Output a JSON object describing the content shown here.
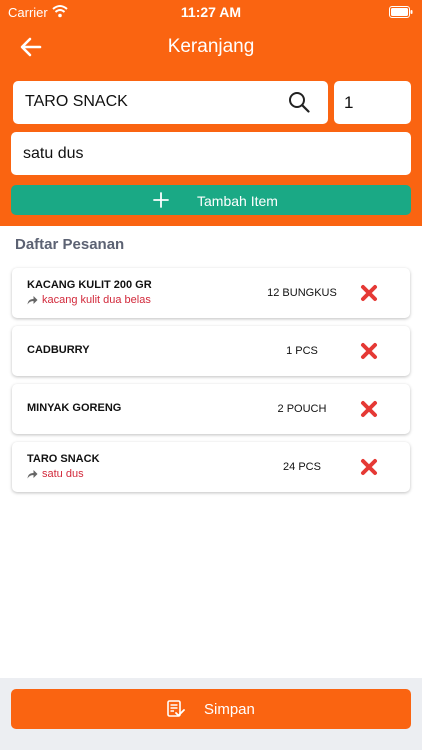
{
  "status_bar": {
    "carrier": "Carrier",
    "time": "11:27 AM"
  },
  "header": {
    "title": "Keranjang"
  },
  "form": {
    "item_value": "TARO SNACK",
    "quantity_value": "1",
    "note_value": "satu dus",
    "add_label": "Tambah Item"
  },
  "section_title": "Daftar Pesanan",
  "orders": [
    {
      "name": "KACANG KULIT 200 GR",
      "note": "kacang kulit dua belas",
      "qty": "12 BUNGKUS"
    },
    {
      "name": "CADBURRY",
      "note": "",
      "qty": "1 PCS"
    },
    {
      "name": "MINYAK GORENG",
      "note": "",
      "qty": "2 POUCH"
    },
    {
      "name": "TARO SNACK",
      "note": "satu dus",
      "qty": "24 PCS"
    }
  ],
  "footer": {
    "save_label": "Simpan"
  },
  "colors": {
    "primary": "#fa6411",
    "accent_green": "#1aa985",
    "note_red": "#d2293b",
    "remove_red": "#e53935"
  },
  "icons": [
    "wifi-icon",
    "battery-icon",
    "back-arrow-icon",
    "search-icon",
    "plus-icon",
    "share-icon",
    "remove-icon",
    "checklist-icon"
  ]
}
